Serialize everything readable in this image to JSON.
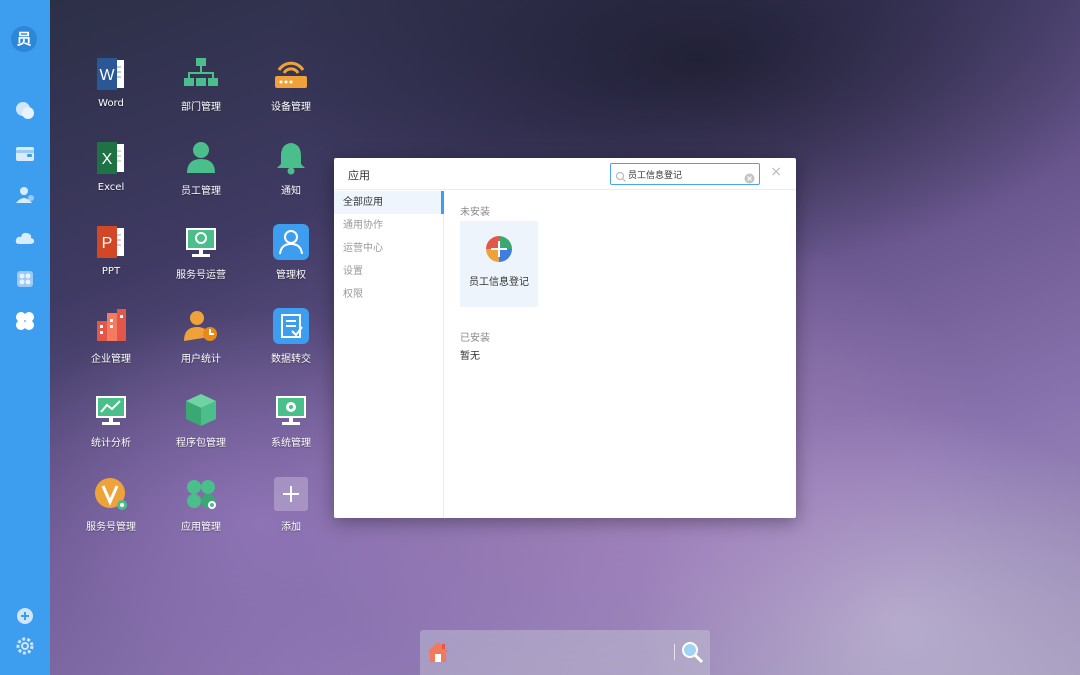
{
  "sidebar": {
    "avatar_text": "员",
    "icons": [
      "chat-icon",
      "wallet-icon",
      "contacts-icon",
      "cloud-icon",
      "apps-grid-icon",
      "clover-icon",
      "add-circle-icon",
      "gear-icon"
    ]
  },
  "desktop": {
    "apps": [
      {
        "label": "Word",
        "icon": "word-icon"
      },
      {
        "label": "部门管理",
        "icon": "org-chart-icon"
      },
      {
        "label": "设备管理",
        "icon": "router-icon"
      },
      {
        "label": "Excel",
        "icon": "excel-icon"
      },
      {
        "label": "员工管理",
        "icon": "person-icon"
      },
      {
        "label": "通知",
        "icon": "bell-icon"
      },
      {
        "label": "PPT",
        "icon": "ppt-icon"
      },
      {
        "label": "服务号运营",
        "icon": "monitor-icon"
      },
      {
        "label": "管理权",
        "icon": "admin-user-icon"
      },
      {
        "label": "企业管理",
        "icon": "building-icon"
      },
      {
        "label": "用户统计",
        "icon": "user-stats-icon"
      },
      {
        "label": "数据转交",
        "icon": "document-transfer-icon"
      },
      {
        "label": "统计分析",
        "icon": "line-chart-monitor-icon"
      },
      {
        "label": "程序包管理",
        "icon": "package-icon"
      },
      {
        "label": "系统管理",
        "icon": "system-monitor-icon"
      },
      {
        "label": "服务号管理",
        "icon": "v-badge-icon"
      },
      {
        "label": "应用管理",
        "icon": "clover-apps-icon"
      },
      {
        "label": "添加",
        "icon": "plus-icon"
      }
    ]
  },
  "dialog": {
    "title": "应用",
    "search_value": "员工信息登记",
    "close_glyph": "×",
    "nav": [
      "全部应用",
      "通用协作",
      "运营中心",
      "设置",
      "权限"
    ],
    "not_installed_label": "未安装",
    "result_app_name": "员工信息登记",
    "installed_label": "已安装",
    "installed_empty": "暂无"
  },
  "colors": {
    "sidebar": "#3d9eef",
    "accent": "#3d9eef"
  }
}
